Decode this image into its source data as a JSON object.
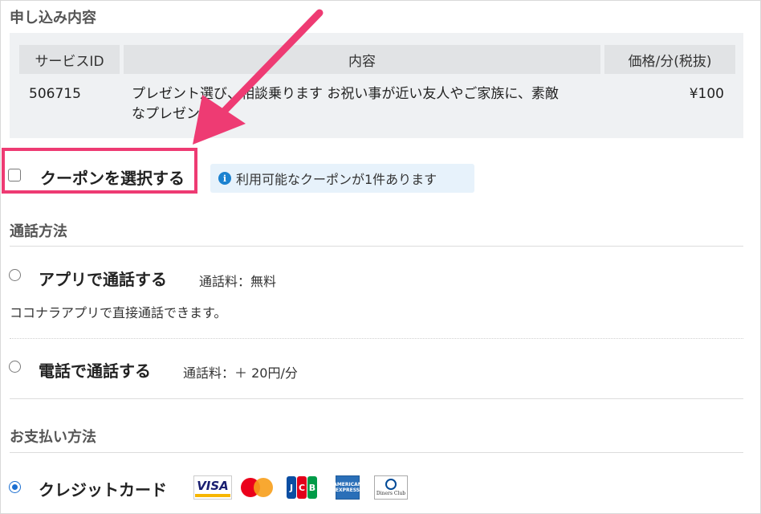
{
  "order": {
    "section_title": "申し込み内容",
    "headers": {
      "service_id": "サービスID",
      "content": "内容",
      "price": "価格/分(税抜)"
    },
    "row": {
      "service_id": "506715",
      "content_line1": "プレゼント選び、相談乗ります お祝い事が近い友人やご家族に、素敵",
      "content_line2": "なプレゼントを",
      "price": "¥100"
    }
  },
  "coupon": {
    "label": "クーポンを選択する",
    "checked": false,
    "info_icon": "info-icon",
    "info_text": "利用可能なクーポンが1件あります"
  },
  "call_method": {
    "section_title": "通話方法",
    "options": [
      {
        "label": "アプリで通話する",
        "fee": "通話料：無料",
        "description": "ココナラアプリで直接通話できます。",
        "selected": false
      },
      {
        "label": "電話で通話する",
        "fee": "通話料：＋ 20円/分",
        "selected": false
      }
    ]
  },
  "payment": {
    "section_title": "お支払い方法",
    "options": [
      {
        "label": "クレジットカード",
        "selected": true
      }
    ],
    "card_brands": {
      "visa": "VISA",
      "mastercard": "mastercard-icon",
      "jcb": "JCB",
      "amex": "AMERICAN EXPRESS",
      "diners": "Diners Club"
    }
  },
  "annotation": {
    "arrow_color": "#ee3b73",
    "highlight_color": "#ee3b73"
  }
}
